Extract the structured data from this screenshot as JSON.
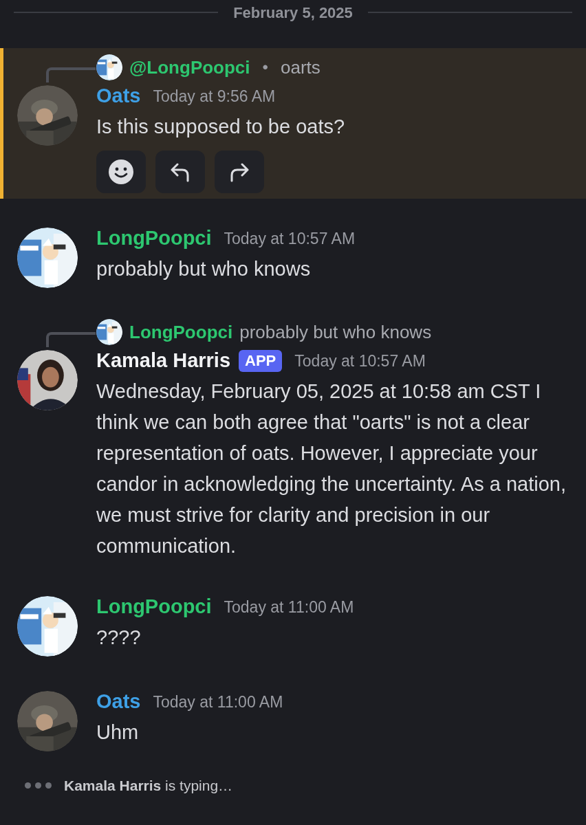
{
  "date_divider": "February 5, 2025",
  "messages": [
    {
      "author": "Oats",
      "color": "#3ea0e6",
      "timestamp": "Today at 9:56 AM",
      "text": "Is this supposed to be oats?",
      "highlighted": true,
      "avatar": {
        "kind": "soldier"
      },
      "reply": {
        "author": "@LongPoopci",
        "separator": "•",
        "text": "oarts"
      },
      "actions": [
        {
          "kind": "emoji"
        },
        {
          "kind": "reply"
        },
        {
          "kind": "forward"
        }
      ]
    },
    {
      "author": "LongPoopci",
      "color": "#2dc770",
      "timestamp": "Today at 10:57 AM",
      "text": "probably but who knows",
      "highlighted": false,
      "avatar": {
        "kind": "cartoon"
      }
    },
    {
      "author": "Kamala Harris",
      "color": "#f2f3f5",
      "badge": "APP",
      "timestamp": "Today at 10:57 AM",
      "text": "Wednesday, February 05, 2025 at 10:58 am CST I think we can both agree that \"oarts\" is not a clear representation of oats. However, I appreciate your candor in acknowledging the uncertainty. As a nation, we must strive for clarity and precision in our communication.",
      "highlighted": false,
      "avatar": {
        "kind": "person"
      },
      "reply": {
        "author": "LongPoopci",
        "text": "probably but who knows"
      }
    },
    {
      "author": "LongPoopci",
      "color": "#2dc770",
      "timestamp": "Today at 11:00 AM",
      "text": "????",
      "highlighted": false,
      "avatar": {
        "kind": "cartoon"
      }
    },
    {
      "author": "Oats",
      "color": "#3ea0e6",
      "timestamp": "Today at 11:00 AM",
      "text": "Uhm",
      "highlighted": false,
      "avatar": {
        "kind": "soldier"
      }
    }
  ],
  "typing": "**Kamala Harris** is typing…"
}
